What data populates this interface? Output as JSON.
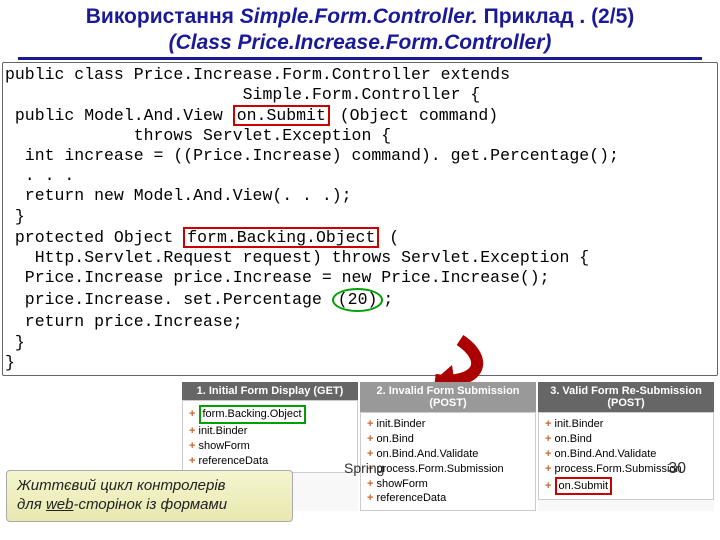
{
  "title": {
    "t1": "Використання ",
    "t2": "Simple.Form.Controller.",
    "t3": " Приклад . (2/5)",
    "t4": "(Class Price.Increase.Form.Controller)"
  },
  "code": {
    "l1": "public class Price.Increase.Form.Controller extends",
    "l2": "                        Simple.Form.Controller {",
    "l3a": " public Model.And.View ",
    "l3b": "on.Submit",
    "l3c": " (Object command)",
    "l4": "             throws Servlet.Exception {",
    "l5": "  int increase = ((Price.Increase) command). get.Percentage();",
    "l6": "  . . .",
    "l7": "  return new Model.And.View(. . .);",
    "l8": " }",
    "l9a": " protected Object ",
    "l9b": "form.Backing.Object",
    "l9c": " (",
    "l10": "   Http.Servlet.Request request) throws Servlet.Exception {",
    "l11": "  Price.Increase price.Increase = new Price.Increase();",
    "l12a": "  price.Increase. set.Percentage ",
    "l12b": "(20)",
    "l12c": ";",
    "l13": "  return price.Increase;",
    "l14": " }",
    "l15": "}"
  },
  "panels": [
    {
      "head": "1. Initial Form Display (GET)",
      "items": [
        "form.Backing.Object",
        "init.Binder",
        "showForm",
        "referenceData"
      ],
      "highlight_index": 0,
      "highlight_class": "hl-green"
    },
    {
      "head": "2. Invalid Form Submission (POST)",
      "items": [
        "init.Binder",
        "on.Bind",
        "on.Bind.And.Validate",
        "process.Form.Submission",
        "showForm",
        "referenceData"
      ],
      "highlight_index": -1,
      "highlight_class": ""
    },
    {
      "head": "3. Valid Form Re-Submission (POST)",
      "items": [
        "init.Binder",
        "on.Bind",
        "on.Bind.And.Validate",
        "process.Form.Submission",
        "on.Submit"
      ],
      "highlight_index": 4,
      "highlight_class": "hl-red"
    }
  ],
  "footer": {
    "label_a": "Життєвий цикл контролерів",
    "label_b": "для ",
    "label_u": "web",
    "label_c": "-сторінок із формами",
    "center": "Spring",
    "page": "30"
  }
}
